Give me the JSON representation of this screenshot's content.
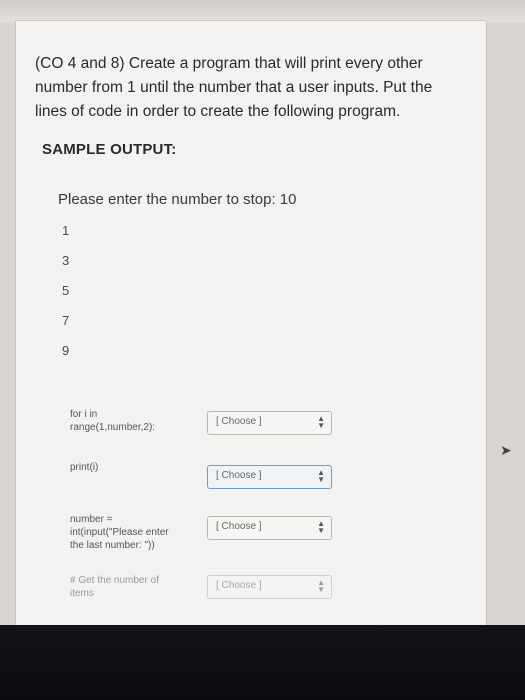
{
  "question": {
    "lines": [
      "(CO 4 and 8) Create a program that will print every other",
      "number from 1 until the number that a user inputs. Put the",
      "lines of code in order to create the following program."
    ],
    "sample_title": "SAMPLE OUTPUT:"
  },
  "sample_output": {
    "prompt": "Please enter the number to stop: 10",
    "numbers": [
      "1",
      "3",
      "5",
      "7",
      "9"
    ]
  },
  "items": [
    {
      "code": [
        "for i in",
        "range(1,number,2):"
      ],
      "choice": "[ Choose ]"
    },
    {
      "code": [
        "print(i)"
      ],
      "choice": "[ Choose ]"
    },
    {
      "code": [
        "number =",
        "int(input(\"Please enter",
        "the last number: \"))"
      ],
      "choice": "[ Choose ]"
    },
    {
      "code": [
        "# Get the number of",
        "items"
      ],
      "choice": "[ Choose ]"
    }
  ],
  "colors": {
    "card": "#f3f2f0",
    "active_border": "#6a9fd0"
  }
}
